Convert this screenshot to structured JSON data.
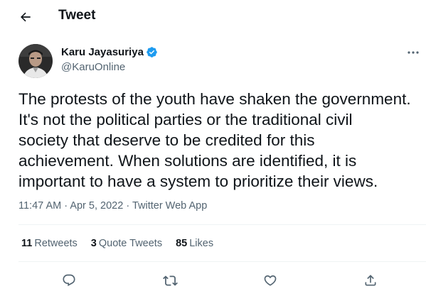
{
  "header": {
    "title": "Tweet",
    "back_icon": "arrow-left-icon"
  },
  "author": {
    "name": "Karu Jayasuriya",
    "handle": "@KaruOnline",
    "verified": true
  },
  "tweet": {
    "lines": [
      "The protests of the youth have shaken the government.",
      "It's not the political parties or the traditional civil",
      "society that deserve to be credited for this",
      "achievement. When solutions are identified, it is",
      "important to have a system to prioritize their views."
    ],
    "time": "11:47 AM",
    "separator": "·",
    "date": "Apr 5, 2022",
    "source": "Twitter Web App"
  },
  "stats": {
    "retweets": {
      "count": "11",
      "label": "Retweets"
    },
    "quotes": {
      "count": "3",
      "label": "Quote Tweets"
    },
    "likes": {
      "count": "85",
      "label": "Likes"
    }
  },
  "actions": [
    "reply-icon",
    "retweet-icon",
    "like-icon",
    "share-icon"
  ],
  "colors": {
    "text": "#0f1419",
    "secondary": "#536471",
    "verified": "#1d9bf0",
    "divider": "#eff3f4"
  }
}
